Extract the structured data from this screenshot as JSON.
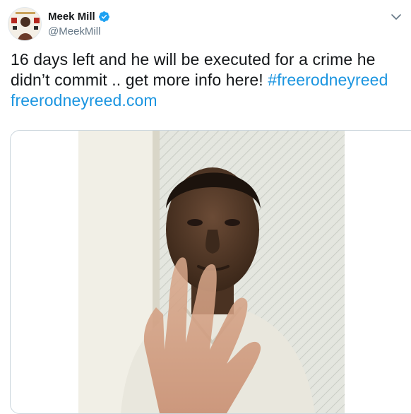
{
  "author": {
    "display_name": "Meek Mill",
    "handle": "@MeekMill",
    "verified": true
  },
  "tweet": {
    "text_part1": "16 days left and he will be executed for a crime he didn’t commit  .. get more info here! ",
    "hashtag": "#freerodneyreed",
    "link": "freerodneyreed.com"
  },
  "icons": {
    "verified": "verified-badge-icon",
    "more": "chevron-down-icon"
  },
  "colors": {
    "link": "#1b95e0",
    "verified": "#1da1f2",
    "text": "#14171a",
    "secondary": "#657786"
  }
}
